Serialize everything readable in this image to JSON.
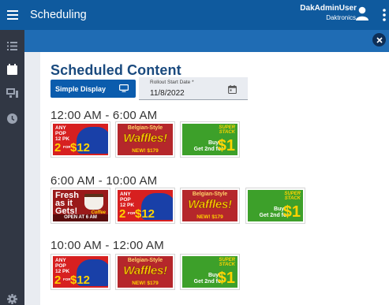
{
  "app": {
    "title": "Scheduling",
    "user_name": "DakAdminUser",
    "user_org": "Daktronics",
    "brand_color": "#0f5a9e"
  },
  "rail": {
    "items": [
      {
        "icon": "list-icon"
      },
      {
        "icon": "calendar-check-icon",
        "active": true
      },
      {
        "icon": "display-icon"
      },
      {
        "icon": "clock-icon"
      },
      {
        "icon": "gear-icon"
      }
    ]
  },
  "panel": {
    "heading": "Scheduled Content",
    "display_button": "Simple Display",
    "date_label": "Rollout Start Date *",
    "date_value": "11/8/2022"
  },
  "ads": {
    "pop": {
      "line1": "ANY",
      "line2": "POP",
      "line3": "12 PK",
      "price_left": "2",
      "for": "FOR",
      "price_right": "$12"
    },
    "waffles": {
      "top": "Belgian-Style",
      "main": "Waffles!",
      "price": "NEW! $179"
    },
    "stack": {
      "top": "SUPER",
      "top2": "STACK",
      "line1": "Buy 1",
      "line2": "Get 2nd for",
      "big": "$1"
    },
    "coffee": {
      "line1": "Fresh",
      "line2": "as it",
      "line3": "Gets!",
      "tag": "Coffee",
      "banner": "OPEN AT 6 AM"
    }
  },
  "schedule": [
    {
      "label": "12:00 AM - 6:00 AM",
      "items": [
        "pop",
        "waffles",
        "stack"
      ]
    },
    {
      "label": "6:00 AM - 10:00 AM",
      "items": [
        "coffee",
        "pop",
        "waffles",
        "stack"
      ]
    },
    {
      "label": "10:00 AM - 12:00 AM",
      "items": [
        "pop",
        "waffles",
        "stack"
      ]
    }
  ]
}
